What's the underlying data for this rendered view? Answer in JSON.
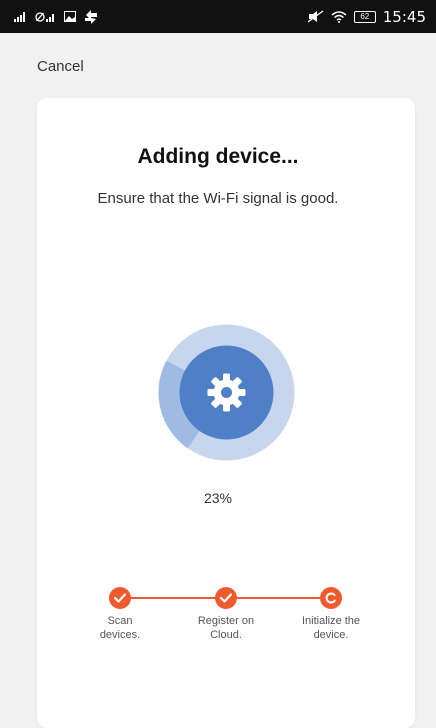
{
  "status_bar": {
    "time": "15:45",
    "battery": "62",
    "icons": [
      "signal-icon",
      "no-signal-icon",
      "image-icon",
      "transfer-icon",
      "mute-icon",
      "wifi-icon",
      "battery-icon"
    ]
  },
  "header": {
    "cancel_label": "Cancel"
  },
  "card": {
    "title": "Adding device...",
    "subtitle": "Ensure that the Wi-Fi signal is good.",
    "progress": {
      "percent_label": "23%",
      "value": 0.23
    },
    "steps": [
      {
        "line1": "Scan",
        "line2": "devices.",
        "state": "done"
      },
      {
        "line1": "Register on",
        "line2": "Cloud.",
        "state": "done"
      },
      {
        "line1": "Initialize the",
        "line2": "device.",
        "state": "in-progress"
      }
    ]
  },
  "colors": {
    "accent": "#ef5a2f",
    "ring_light": "#c7d6ec",
    "ring_mid": "#9fbbe3",
    "ring_core": "#4f7fc7"
  }
}
